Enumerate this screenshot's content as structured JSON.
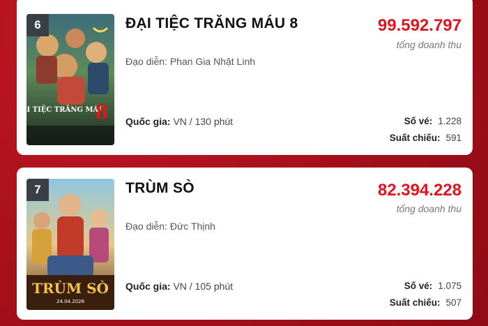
{
  "movies": [
    {
      "rank": "6",
      "title": "ĐẠI TIỆC TRĂNG MÁU 8",
      "gross": "99.592.797",
      "gross_label": "tổng doanh thu",
      "director_label": "Đạo diễn:",
      "director": "Phan Gia Nhật Linh",
      "country_label": "Quốc gia:",
      "country_runtime": "VN / 130 phút",
      "tickets_label": "Số vé:",
      "tickets": "1.228",
      "showings_label": "Suất chiếu:",
      "showings": "591",
      "poster_text": "ĐẠI TIỆC TRĂNG MÁU"
    },
    {
      "rank": "7",
      "title": "TRÙM SÒ",
      "gross": "82.394.228",
      "gross_label": "tổng doanh thu",
      "director_label": "Đạo diễn:",
      "director": "Đức Thịnh",
      "country_label": "Quốc gia:",
      "country_runtime": "VN / 105 phút",
      "tickets_label": "Số vé:",
      "tickets": "1.075",
      "showings_label": "Suất chiếu:",
      "showings": "507",
      "poster_text": "TRÙM SÒ",
      "poster_date": "24.04.2026"
    }
  ],
  "colors": {
    "background": "#b0111d",
    "gross": "#e0141e",
    "rank_badge": "#3a3f47"
  }
}
